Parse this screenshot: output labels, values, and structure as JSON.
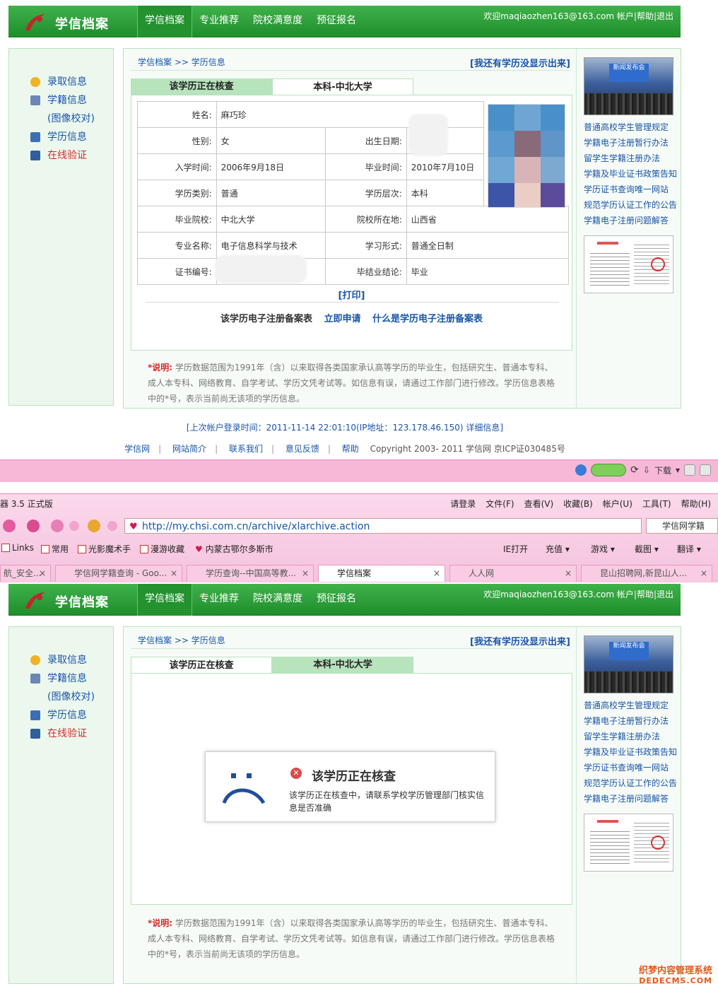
{
  "site": {
    "logo_text": "学信档案",
    "nav": [
      "学信档案",
      "专业推荐",
      "院校满意度",
      "预征报名"
    ],
    "user_bar": "欢迎maqiaozhen163@163.com 帐户|帮助|退出"
  },
  "sidebar": {
    "items": [
      {
        "label": "录取信息"
      },
      {
        "label": "学籍信息"
      },
      {
        "label": "(图像校对)"
      },
      {
        "label": "学历信息"
      },
      {
        "label": "在线验证"
      }
    ]
  },
  "main": {
    "breadcrumb": "学信档案 >> 学历信息",
    "missing_link": "[我还有学历没显示出来]",
    "tabs": [
      "该学历正在核查",
      "本科-中北大学"
    ],
    "record": {
      "name_label": "姓名:",
      "name": "麻巧珍",
      "gender_label": "性别:",
      "gender": "女",
      "birth_label": "出生日期:",
      "enroll_label": "入学时间:",
      "enroll": "2006年9月18日",
      "grad_label": "毕业时间:",
      "grad": "2010年7月10日",
      "type_label": "学历类别:",
      "type": "普通",
      "level_label": "学历层次:",
      "level": "本科",
      "school_label": "毕业院校:",
      "school": "中北大学",
      "location_label": "院校所在地:",
      "location": "山西省",
      "major_label": "专业名称:",
      "major": "电子信息科学与技术",
      "form_label": "学习形式:",
      "form": "普通全日制",
      "cert_label": "证书编号:",
      "conclusion_label": "毕结业结论:",
      "conclusion": "毕业"
    },
    "print": "[打印]",
    "reg_text": "该学历电子注册备案表",
    "reg_apply": "立即申请",
    "reg_what": "什么是学历电子注册备案表",
    "note_label": "*说明:",
    "note_text": "学历数据范围为1991年（含）以来取得各类国家承认高等学历的毕业生，包括研究生、普通本专科、成人本专科、网络教育、自学考试、学历文凭考试等。如信息有误，请通过工作部门进行修改。学历信息表格中的*号，表示当前尚无该项的学历信息。"
  },
  "right_links": [
    "普通高校学生管理规定",
    "学籍电子注册暂行办法",
    "留学生学籍注册办法",
    "学籍及毕业证书政策告知",
    "学历证书查询唯一网站",
    "规范学历认证工作的公告",
    "学籍电子注册问题解答"
  ],
  "news_image_text": "新闻发布会",
  "last_login": "[上次帐户登录时间：2011-11-14 22:01:10(IP地址：123.178.46.150)",
  "last_login_link": "详细信息]",
  "footer": {
    "links": [
      "学信网",
      "网站简介",
      "联系我们",
      "意见反馈",
      "帮助"
    ],
    "copyright": "Copyright 2003- 2011 学信网 京ICP证030485号"
  },
  "statusbar": {
    "download": "下载"
  },
  "browser": {
    "title": "器 3.5 正式版",
    "menu": [
      "请登录",
      "文件(F)",
      "查看(V)",
      "收藏(B)",
      "帐户(U)",
      "工具(T)",
      "帮助(H)"
    ],
    "url": "http://my.chsi.com.cn/archive/xlarchive.action",
    "search": "学信网学籍",
    "favorites": [
      "Links",
      "常用",
      "光影魔术手",
      "漫游收藏",
      "内蒙古鄂尔多斯市",
      "IE打开",
      "充值",
      "游戏",
      "截图",
      "翻译"
    ],
    "tabs": [
      "航_安全...",
      "学信网学籍查询 - Goo...",
      "学历查询--中国高等教...",
      "学信档案",
      "人人网",
      "昆山招聘网,新昆山人..."
    ]
  },
  "error": {
    "title": "该学历正在核查",
    "message": "该学历正在核查中，请联系学校学历管理部门核实信息是否准确"
  },
  "watermark": {
    "line1": "织梦内容管理系统",
    "line2": "DEDECMS.COM"
  },
  "colors": {
    "brand_green": "#2a9c36",
    "link_blue": "#1a55a8",
    "alert_red": "#d42b2b",
    "browser_pink": "#f7b8d8"
  }
}
